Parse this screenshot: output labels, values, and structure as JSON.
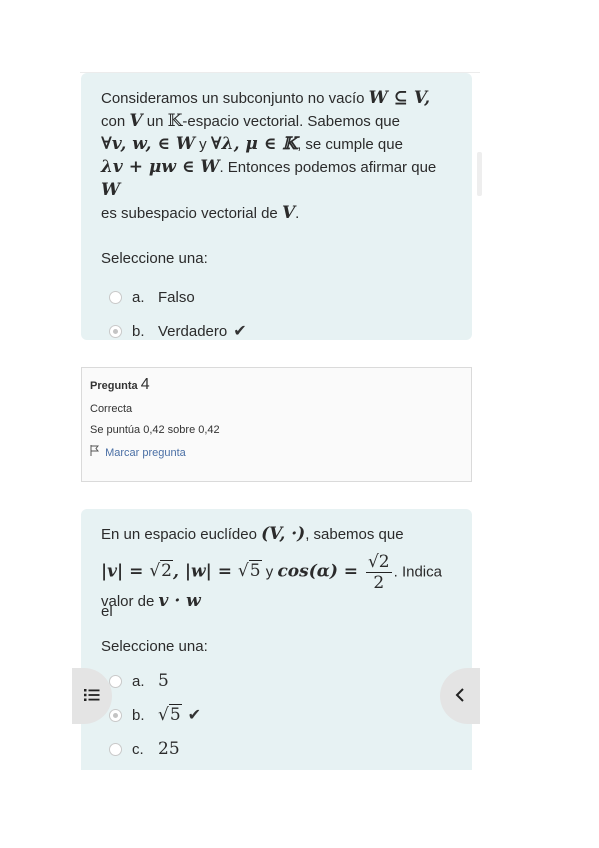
{
  "q3": {
    "line1": "Consideramos un subconjunto no vacío ",
    "m1": "W ⊆ V,",
    "line2a": "con ",
    "m2": "V",
    "line2b": " un ",
    "m3": "𝕂",
    "line2c": "-espacio vectorial. Sabemos que",
    "m4": "∀v, w, ∈ W",
    "line3a": " y ",
    "m5": "∀λ, μ ∈ 𝕂",
    "line3b": ", se cumple que",
    "m6": "λv + μw ∈ W",
    "line4a": ". Entonces podemos afirmar que ",
    "m7": "W",
    "line5a": "es subespacio vectorial de ",
    "m8": "V",
    "line5b": ".",
    "prompt": "Seleccione una:",
    "options": [
      {
        "letter": "a.",
        "label": "Falso",
        "selected": false
      },
      {
        "letter": "b.",
        "label": "Verdadero",
        "selected": true,
        "correct": true
      }
    ]
  },
  "info": {
    "label": "Pregunta",
    "number": "4",
    "status": "Correcta",
    "score": "Se puntúa 0,42 sobre 0,42",
    "flag": "Marcar pregunta"
  },
  "q4": {
    "line1": "En un espacio euclídeo ",
    "m1": "(V, ·)",
    "line1b": ", sabemos que",
    "m2a": "|v| = ",
    "m2b": "2",
    "m2c": ", |w| = ",
    "m2d": "5",
    "line2a": " y ",
    "m3": "cos(α) = ",
    "frac_num": "2",
    "frac_den": "2",
    "line2b": ". Indica el",
    "line3a": "valor de ",
    "m4": "v · w",
    "prompt": "Seleccione una:",
    "options": [
      {
        "letter": "a.",
        "label": "5",
        "selected": false
      },
      {
        "letter": "b.",
        "label": "5",
        "selected": true,
        "correct": true
      },
      {
        "letter": "c.",
        "label": "25",
        "selected": false
      }
    ]
  },
  "icons": {
    "check": "✔",
    "left": "list-icon",
    "right": "chevron-left-icon"
  }
}
